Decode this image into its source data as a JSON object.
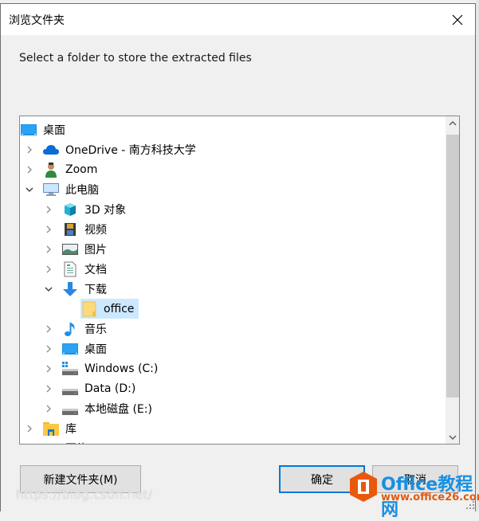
{
  "window": {
    "title": "浏览文件夹",
    "close_icon": "close-icon"
  },
  "prompt": "Select a folder to store the extracted files",
  "tree": {
    "items": [
      {
        "label": "桌面",
        "icon": "desktop-icon",
        "expander": "none",
        "level": 0
      },
      {
        "label": "OneDrive - 南方科技大学",
        "icon": "onedrive-cloud-icon",
        "expander": "collapsed",
        "level": 1
      },
      {
        "label": "Zoom",
        "icon": "user-icon",
        "expander": "collapsed",
        "level": 1
      },
      {
        "label": "此电脑",
        "icon": "computer-icon",
        "expander": "expanded",
        "level": 1
      },
      {
        "label": "3D 对象",
        "icon": "3d-objects-icon",
        "expander": "collapsed",
        "level": 2
      },
      {
        "label": "视频",
        "icon": "video-icon",
        "expander": "collapsed",
        "level": 2
      },
      {
        "label": "图片",
        "icon": "pictures-icon",
        "expander": "collapsed",
        "level": 2
      },
      {
        "label": "文档",
        "icon": "documents-icon",
        "expander": "collapsed",
        "level": 2
      },
      {
        "label": "下载",
        "icon": "downloads-icon",
        "expander": "expanded",
        "level": 2
      },
      {
        "label": "office",
        "icon": "folder-icon",
        "expander": "none",
        "level": 3,
        "selected": true
      },
      {
        "label": "音乐",
        "icon": "music-icon",
        "expander": "collapsed",
        "level": 2
      },
      {
        "label": "桌面",
        "icon": "desktop-icon",
        "expander": "collapsed",
        "level": 2
      },
      {
        "label": "Windows (C:)",
        "icon": "windows-drive-icon",
        "expander": "collapsed",
        "level": 2
      },
      {
        "label": "Data (D:)",
        "icon": "drive-icon",
        "expander": "collapsed",
        "level": 2
      },
      {
        "label": "本地磁盘 (E:)",
        "icon": "drive-icon",
        "expander": "collapsed",
        "level": 2
      },
      {
        "label": "库",
        "icon": "library-icon",
        "expander": "collapsed",
        "level": 1
      },
      {
        "label": "网络",
        "icon": "network-icon",
        "expander": "collapsed",
        "level": 1
      }
    ]
  },
  "buttons": {
    "new_folder": "新建文件夹(M)",
    "ok": "确定",
    "cancel": "取消"
  },
  "watermark": {
    "url": "https://blog.csdn.net/",
    "brand": "Office教程网",
    "site": "www.office26.com"
  },
  "colors": {
    "accent": "#0078d7",
    "selection": "#cce8ff"
  }
}
